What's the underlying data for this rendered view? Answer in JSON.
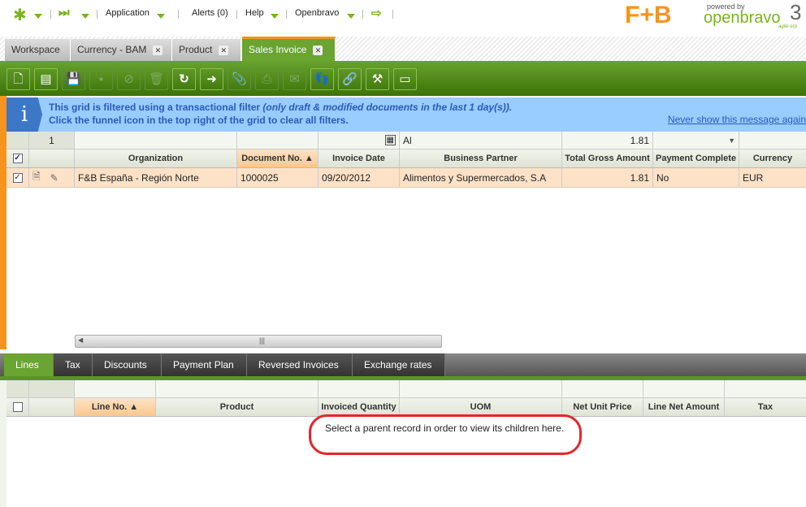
{
  "nav": {
    "application": "Application",
    "alerts": "Alerts (0)",
    "help": "Help",
    "user": "Openbravo"
  },
  "logo": {
    "brand": "F+B",
    "powered": "powered by",
    "product": "openbravo",
    "version": "3",
    "tagline": "agile erp"
  },
  "tabs": [
    {
      "label": "Workspace"
    },
    {
      "label": "Currency - BAM"
    },
    {
      "label": "Product"
    },
    {
      "label": "Sales Invoice"
    }
  ],
  "toolbar": [
    "new-document",
    "new-row",
    "save",
    "undo",
    "cancel",
    "delete",
    "refresh",
    "export",
    "attach",
    "print",
    "email",
    "audit-trail",
    "link",
    "customize-grid",
    "layout"
  ],
  "info": {
    "line1": "This grid is filtered using a transactional filter ",
    "line1_em": "(only draft & modified documents in the last 1 day(s)).",
    "line2": "Click the funnel icon in the top right of the grid to clear all filters.",
    "dismiss": "Never show this message again"
  },
  "grid": {
    "filter": {
      "count": "1",
      "bp": "Al",
      "total": "1.81"
    },
    "columns": [
      "Organization",
      "Document No.",
      "Invoice Date",
      "Business Partner",
      "Total Gross Amount",
      "Payment Complete",
      "Currency"
    ],
    "rows": [
      {
        "org": "F&B España - Región Norte",
        "doc": "1000025",
        "date": "09/20/2012",
        "bp": "Alimentos y Supermercados, S.A",
        "total": "1.81",
        "paid": "No",
        "cur": "EUR"
      }
    ]
  },
  "subtabs": [
    {
      "label": "Lines"
    },
    {
      "label": "Tax"
    },
    {
      "label": "Discounts"
    },
    {
      "label": "Payment Plan"
    },
    {
      "label": "Reversed Invoices"
    },
    {
      "label": "Exchange rates"
    }
  ],
  "lines": {
    "columns": [
      "Line No.",
      "Product",
      "Invoiced Quantity",
      "UOM",
      "Net Unit Price",
      "Line Net Amount",
      "Tax"
    ],
    "empty_message": "Select a parent record in order to view its children here."
  }
}
